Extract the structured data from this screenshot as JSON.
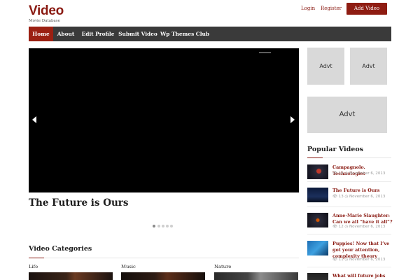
{
  "header": {
    "logo_title": "Video",
    "logo_subtitle": "Movie Database",
    "login": "Login",
    "register": "Register",
    "add_video": "Add Video",
    "accent_color": "#8e1c12"
  },
  "nav": {
    "items": [
      {
        "label": "Home",
        "active": true
      },
      {
        "label": "About"
      },
      {
        "label": "Edit Profile"
      },
      {
        "label": "Submit Video"
      },
      {
        "label": "Wp Themes Club"
      }
    ]
  },
  "slider": {
    "title": "The Future is Ours",
    "prev_icon": "chevron-left-icon",
    "next_icon": "chevron-right-icon",
    "slide_count": 5,
    "active_slide": 1
  },
  "categories": {
    "title": "Video Categories",
    "items": [
      {
        "label": "Life"
      },
      {
        "label": "Music"
      },
      {
        "label": "Nature"
      }
    ]
  },
  "ads": {
    "small_1": "Advt",
    "small_2": "Advt",
    "large": "Advt"
  },
  "popular": {
    "title": "Popular Videos",
    "eye_icon": "eye-icon",
    "clock_icon": "clock-icon",
    "items": [
      {
        "title": "Campagnolo. Technologies",
        "views": "14",
        "date": "November 6, 2013"
      },
      {
        "title": "The Future is Ours",
        "views": "13",
        "date": "November 6, 2013"
      },
      {
        "title": "Anne-Marie Slaughter: Can we all “have it all”?",
        "views": "12",
        "date": "November 6, 2013"
      },
      {
        "title": "Puppies! Now that I’ve got your attention, complexity theory",
        "views": "11",
        "date": "November 6, 2013"
      },
      {
        "title": "What will future jobs look like?"
      }
    ]
  }
}
